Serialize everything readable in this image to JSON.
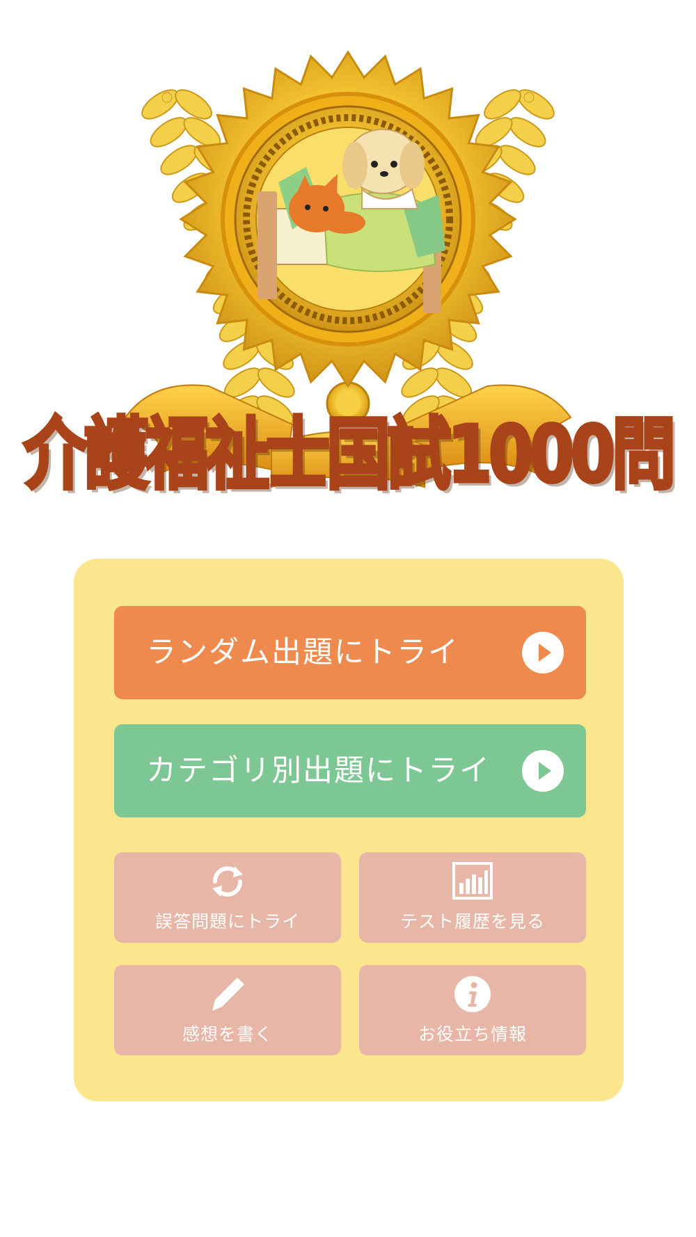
{
  "app": {
    "title": "介護福祉士国試1000問"
  },
  "colors": {
    "panel": "#fbe68d",
    "random_button": "#ef8a4e",
    "category_button": "#7cc794",
    "small_button": "#e8b6a6",
    "title_text": "#a8431a",
    "medal_gold": "#f2c230"
  },
  "menu": {
    "random": {
      "label": "ランダム出題にトライ",
      "icon": "play-icon"
    },
    "category": {
      "label": "カテゴリ別出題にトライ",
      "icon": "play-icon"
    },
    "wrong_answers": {
      "label": "誤答問題にトライ",
      "icon": "refresh-icon"
    },
    "history": {
      "label": "テスト履歴を見る",
      "icon": "bar-chart-icon"
    },
    "feedback": {
      "label": "感想を書く",
      "icon": "pencil-icon"
    },
    "info": {
      "label": "お役立ち情報",
      "icon": "info-icon"
    }
  }
}
